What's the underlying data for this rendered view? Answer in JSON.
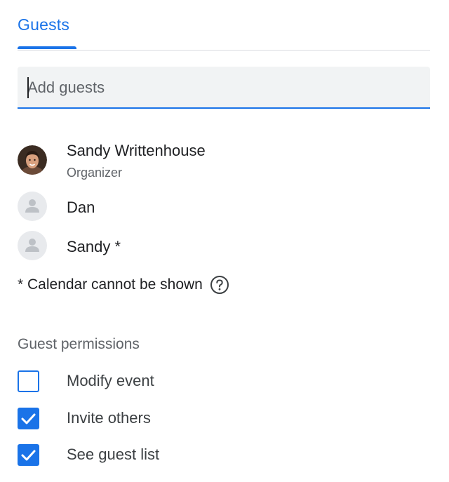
{
  "tabs": {
    "guests_label": "Guests"
  },
  "guest_input": {
    "placeholder": "Add guests",
    "value": ""
  },
  "guests": [
    {
      "name": "Sandy Writtenhouse",
      "role": "Organizer",
      "avatar": "photo-avatar"
    },
    {
      "name": "Dan",
      "role": "",
      "avatar": "person-icon"
    },
    {
      "name": "Sandy *",
      "role": "",
      "avatar": "person-icon"
    }
  ],
  "calendar_note": {
    "text": "* Calendar cannot be shown",
    "icon": "help-circle-icon"
  },
  "permissions": {
    "heading": "Guest permissions",
    "items": [
      {
        "label": "Modify event",
        "checked": false
      },
      {
        "label": "Invite others",
        "checked": true
      },
      {
        "label": "See guest list",
        "checked": true
      }
    ]
  },
  "colors": {
    "accent": "#1a73e8",
    "input_bg": "#f1f3f4",
    "secondary_text": "#5f6368"
  }
}
